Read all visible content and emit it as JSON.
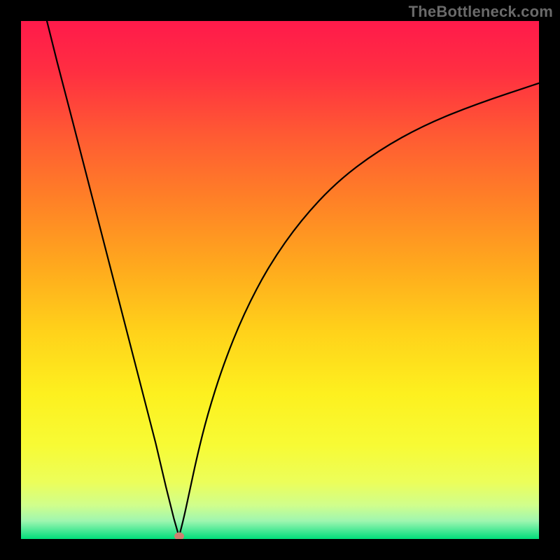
{
  "watermark": "TheBottleneck.com",
  "colors": {
    "marker": "#cf8070",
    "curve": "#000000",
    "frame": "#000000"
  },
  "gradient_stops": [
    {
      "offset": 0.0,
      "color": "#ff1a4b"
    },
    {
      "offset": 0.1,
      "color": "#ff2f41"
    },
    {
      "offset": 0.22,
      "color": "#ff5a33"
    },
    {
      "offset": 0.35,
      "color": "#ff8226"
    },
    {
      "offset": 0.48,
      "color": "#ffab1d"
    },
    {
      "offset": 0.6,
      "color": "#ffd21a"
    },
    {
      "offset": 0.72,
      "color": "#fdf01f"
    },
    {
      "offset": 0.82,
      "color": "#f7fb35"
    },
    {
      "offset": 0.89,
      "color": "#ecfe5a"
    },
    {
      "offset": 0.935,
      "color": "#d0fe8c"
    },
    {
      "offset": 0.965,
      "color": "#9ff6b0"
    },
    {
      "offset": 0.985,
      "color": "#44e893"
    },
    {
      "offset": 1.0,
      "color": "#00df7a"
    }
  ],
  "chart_data": {
    "type": "line",
    "title": "",
    "xlabel": "",
    "ylabel": "",
    "x_range": [
      0,
      100
    ],
    "y_range": [
      0,
      100
    ],
    "minimum_x": 30.5,
    "left_branch": [
      {
        "x": 5.0,
        "y": 100.0
      },
      {
        "x": 7.0,
        "y": 92.0
      },
      {
        "x": 10.0,
        "y": 80.5
      },
      {
        "x": 14.0,
        "y": 65.0
      },
      {
        "x": 18.0,
        "y": 49.5
      },
      {
        "x": 22.0,
        "y": 34.0
      },
      {
        "x": 26.0,
        "y": 18.5
      },
      {
        "x": 28.0,
        "y": 10.0
      },
      {
        "x": 29.5,
        "y": 4.0
      },
      {
        "x": 30.5,
        "y": 0.5
      }
    ],
    "right_branch": [
      {
        "x": 30.5,
        "y": 0.5
      },
      {
        "x": 31.2,
        "y": 3.0
      },
      {
        "x": 32.5,
        "y": 9.0
      },
      {
        "x": 34.0,
        "y": 16.0
      },
      {
        "x": 36.0,
        "y": 24.0
      },
      {
        "x": 39.0,
        "y": 33.5
      },
      {
        "x": 43.0,
        "y": 43.5
      },
      {
        "x": 48.0,
        "y": 53.0
      },
      {
        "x": 54.0,
        "y": 61.5
      },
      {
        "x": 61.0,
        "y": 69.0
      },
      {
        "x": 69.0,
        "y": 75.0
      },
      {
        "x": 78.0,
        "y": 80.0
      },
      {
        "x": 88.0,
        "y": 84.0
      },
      {
        "x": 100.0,
        "y": 88.0
      }
    ],
    "marker": {
      "x": 30.5,
      "y": 0.5
    }
  }
}
